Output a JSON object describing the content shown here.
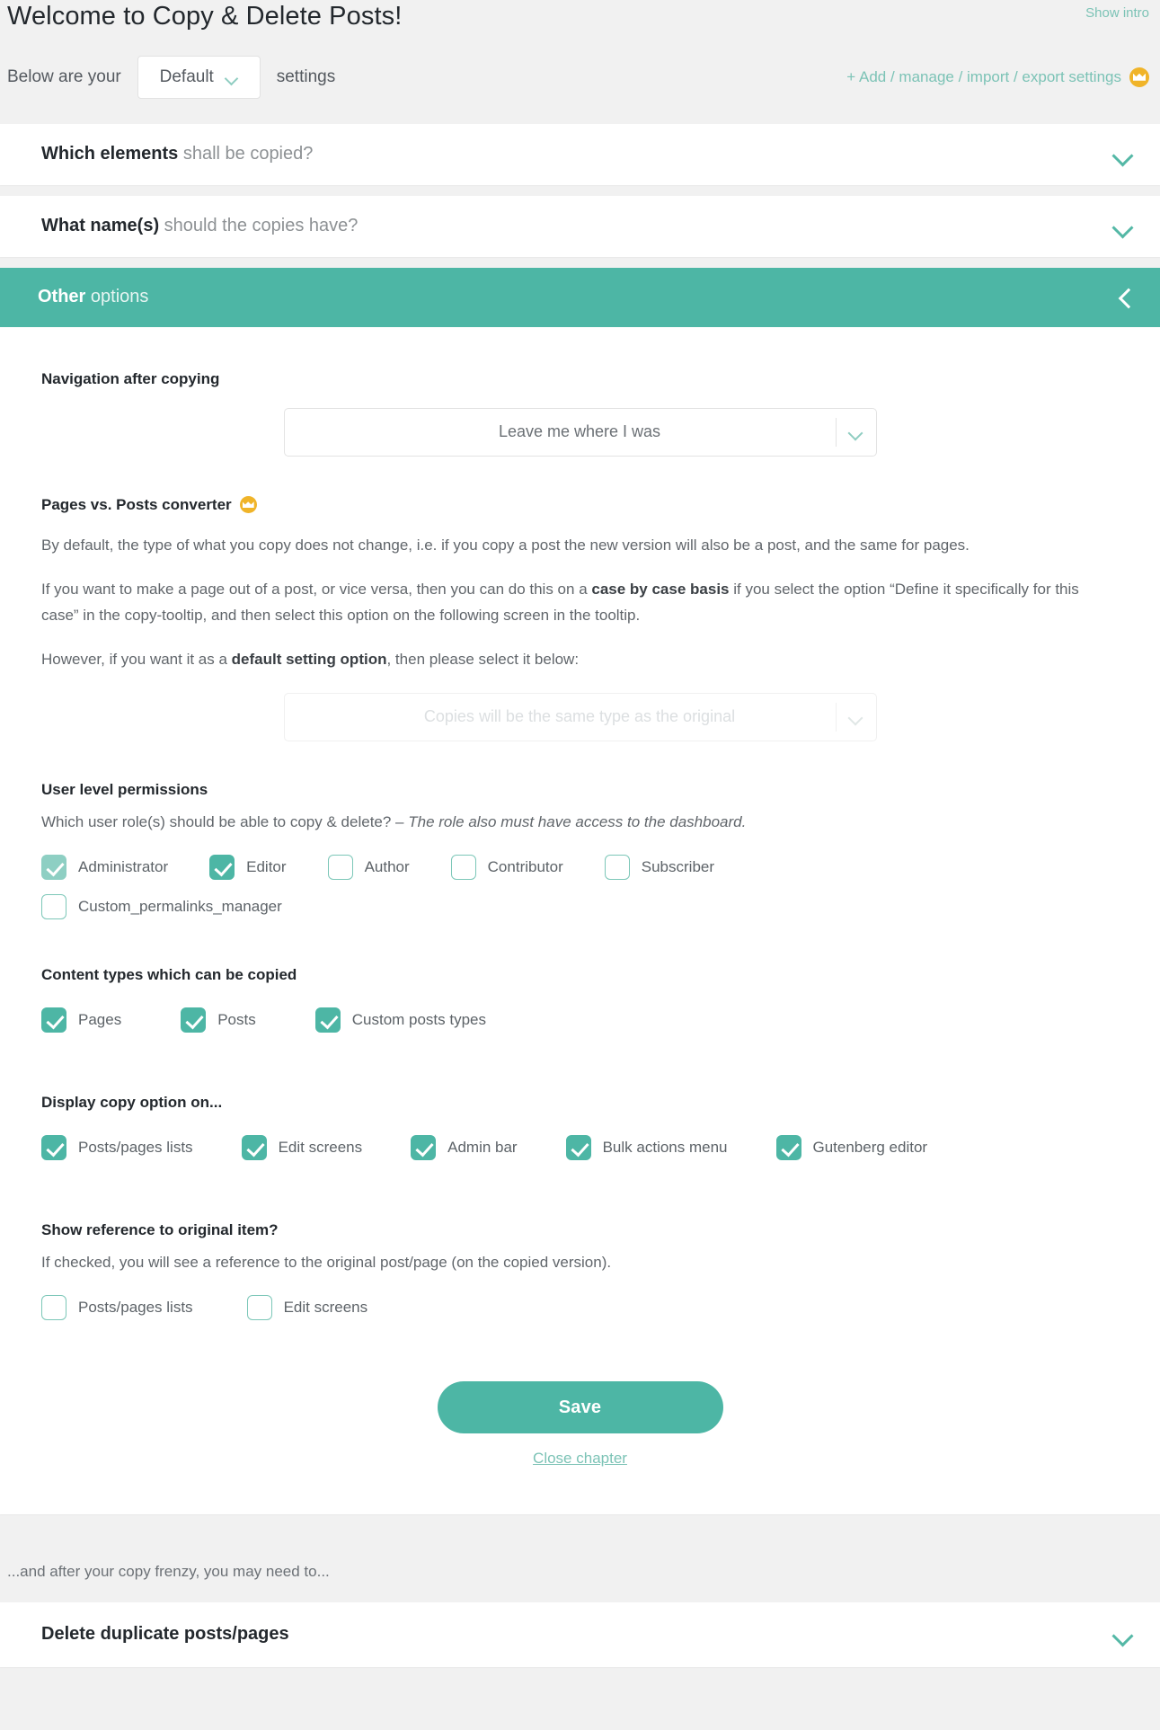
{
  "header": {
    "title": "Welcome to Copy & Delete Posts!",
    "show_intro_label": "Show intro",
    "lead_text": "Below are your",
    "profile_value": "Default",
    "trailing_text": "settings",
    "manage_link_label": "+ Add / manage / import / export settings",
    "crown_icon": "crown-icon"
  },
  "panels": [
    {
      "title_bold": "Which elements",
      "title_rest": " shall be copied?",
      "state": "collapsed"
    },
    {
      "title_bold": "What name(s)",
      "title_rest": " should the copies have?",
      "state": "collapsed"
    },
    {
      "title_bold": "Other",
      "title_rest": " options",
      "state": "expanded"
    }
  ],
  "other_options": {
    "navigation": {
      "label": "Navigation after copying",
      "selected": "Leave me where I was"
    },
    "converter": {
      "label": "Pages vs. Posts converter",
      "premium_badge": "crown-icon",
      "p1": "By default, the type of what you copy does not change, i.e. if you copy a post the new version will also be a post, and the same for pages.",
      "p2_a": "If you want to make a page out of a post, or vice versa, then you can do this on a ",
      "p2_bold": "case by case basis",
      "p2_b": " if you select the option “Define it specifically for this case” in the copy-tooltip, and then select this option on the following screen in the tooltip.",
      "p3_a": "However, if you want it as a ",
      "p3_bold": "default setting option",
      "p3_b": ", then please select it below:",
      "selected": "Copies will be the same type as the original",
      "disabled": true
    },
    "user_permissions": {
      "label": "User level permissions",
      "note_a": "Which user role(s) should be able to copy & delete? – ",
      "note_italic": "The role also must have access to the dashboard.",
      "roles": [
        {
          "label": "Administrator",
          "checked": true,
          "faded": true
        },
        {
          "label": "Editor",
          "checked": true,
          "faded": false
        },
        {
          "label": "Author",
          "checked": false,
          "faded": false
        },
        {
          "label": "Contributor",
          "checked": false,
          "faded": false
        },
        {
          "label": "Subscriber",
          "checked": false,
          "faded": false
        },
        {
          "label": "Custom_permalinks_manager",
          "checked": false,
          "faded": false
        }
      ]
    },
    "content_types": {
      "label": "Content types which can be copied",
      "items": [
        {
          "label": "Pages",
          "checked": true
        },
        {
          "label": "Posts",
          "checked": true
        },
        {
          "label": "Custom posts types",
          "checked": true
        }
      ]
    },
    "display_on": {
      "label": "Display copy option on...",
      "items": [
        {
          "label": "Posts/pages lists",
          "checked": true
        },
        {
          "label": "Edit screens",
          "checked": true
        },
        {
          "label": "Admin bar",
          "checked": true
        },
        {
          "label": "Bulk actions menu",
          "checked": true
        },
        {
          "label": "Gutenberg editor",
          "checked": true
        }
      ]
    },
    "show_reference": {
      "label": "Show reference to original item?",
      "note": "If checked, you will see a reference to the original post/page (on the copied version).",
      "items": [
        {
          "label": "Posts/pages lists",
          "checked": false
        },
        {
          "label": "Edit screens",
          "checked": false
        }
      ]
    },
    "save_label": "Save",
    "close_chapter_label": "Close chapter"
  },
  "footer": {
    "after_note": "...and after your copy frenzy, you may need to...",
    "delete_panel_title": "Delete duplicate posts/pages"
  },
  "colors": {
    "accent": "#4db6a5",
    "accent_light": "#8ecfc3",
    "link": "#7cc3b6",
    "crown": "#f0b429",
    "page_bg": "#f1f1f1"
  }
}
